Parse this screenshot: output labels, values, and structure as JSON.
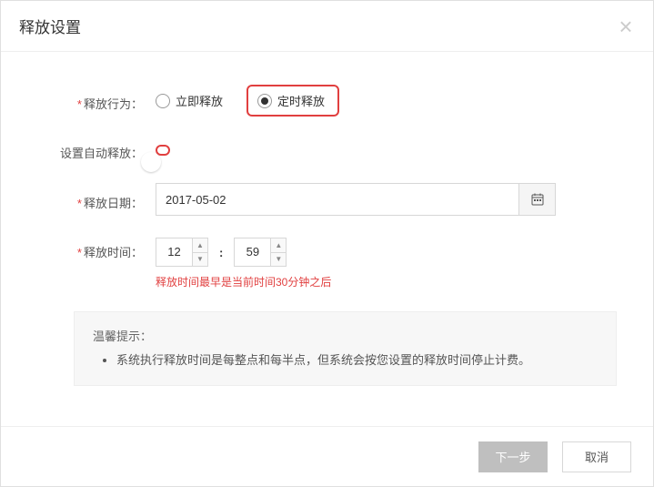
{
  "header": {
    "title": "释放设置"
  },
  "form": {
    "behavior": {
      "label": "释放行为：",
      "required": true,
      "options": {
        "immediate": "立即释放",
        "scheduled": "定时释放"
      },
      "selected": "scheduled"
    },
    "autoRelease": {
      "label": "设置自动释放：",
      "required": false,
      "on": true
    },
    "releaseDate": {
      "label": "释放日期：",
      "required": true,
      "value": "2017-05-02"
    },
    "releaseTime": {
      "label": "释放时间：",
      "required": true,
      "hour": "12",
      "minute": "59",
      "hint": "释放时间最早是当前时间30分钟之后"
    }
  },
  "tips": {
    "title": "温馨提示：",
    "items": [
      "系统执行释放时间是每整点和每半点，但系统会按您设置的释放时间停止计费。"
    ]
  },
  "footer": {
    "next": "下一步",
    "cancel": "取消"
  }
}
